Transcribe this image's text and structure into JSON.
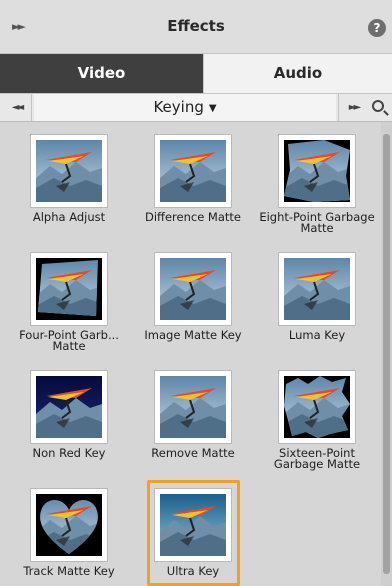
{
  "panel": {
    "title": "Effects",
    "expand_icon": "double-chevron-right-icon",
    "help_icon": "help-icon",
    "help_glyph": "?"
  },
  "tabs": [
    {
      "label": "Video",
      "active": true
    },
    {
      "label": "Audio",
      "active": false
    }
  ],
  "category": {
    "left_nav_icon": "double-chevron-left-icon",
    "right_nav_icon": "double-chevron-right-icon",
    "selected": "Keying",
    "dropdown_icon": "caret-down-icon",
    "search_icon": "search-icon"
  },
  "effects": [
    {
      "name": "Alpha Adjust",
      "selected": false
    },
    {
      "name": "Difference Matte",
      "selected": false
    },
    {
      "name": "Eight-Point Garbage Matte",
      "selected": false
    },
    {
      "name": "Four-Point Garb... Matte",
      "selected": false
    },
    {
      "name": "Image Matte Key",
      "selected": false
    },
    {
      "name": "Luma Key",
      "selected": false
    },
    {
      "name": "Non Red Key",
      "selected": false
    },
    {
      "name": "Remove Matte",
      "selected": false
    },
    {
      "name": "Sixteen-Point Garbage Matte",
      "selected": false
    },
    {
      "name": "Track Matte Key",
      "selected": false
    },
    {
      "name": "Ultra Key",
      "selected": true
    }
  ],
  "colors": {
    "selection": "#f0a21f",
    "active_tab": "#3f3f3f",
    "glider_wing": "#e8472a"
  }
}
